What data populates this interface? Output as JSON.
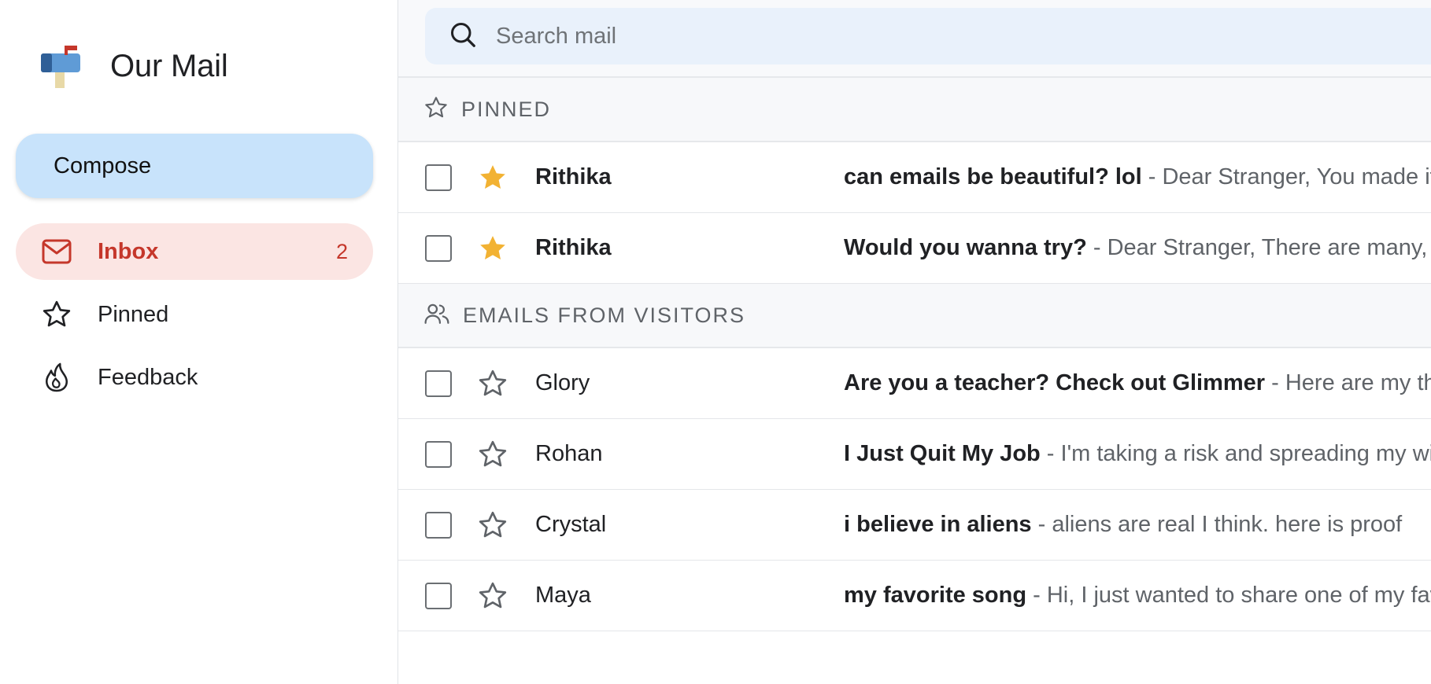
{
  "app": {
    "title": "Our Mail"
  },
  "sidebar": {
    "compose_label": "Compose",
    "items": [
      {
        "label": "Inbox",
        "count": "2",
        "icon": "mail-icon",
        "active": true
      },
      {
        "label": "Pinned",
        "icon": "star-icon"
      },
      {
        "label": "Feedback",
        "icon": "flame-icon"
      }
    ]
  },
  "search": {
    "placeholder": "Search mail"
  },
  "sections": [
    {
      "title": "PINNED",
      "icon": "star-outline-icon",
      "emails": [
        {
          "sender": "Rithika",
          "subject": "can emails be beautiful? lol",
          "separator": " - ",
          "snippet": "Dear Stranger, You made it",
          "starred": true
        },
        {
          "sender": "Rithika",
          "subject": "Would you wanna try?",
          "separator": " - ",
          "snippet": "Dear Stranger, There are many, many",
          "starred": true
        }
      ]
    },
    {
      "title": "EMAILS FROM VISITORS",
      "icon": "users-icon",
      "emails": [
        {
          "sender": "Glory",
          "subject": "Are you a teacher? Check out Glimmer",
          "separator": " - ",
          "snippet": "Here are my thoughts",
          "starred": false
        },
        {
          "sender": "Rohan",
          "subject": "I Just Quit My Job",
          "separator": " - ",
          "snippet": "I'm taking a risk and spreading my wings",
          "starred": false
        },
        {
          "sender": "Crystal",
          "subject": "i believe in aliens",
          "separator": " - ",
          "snippet": "aliens are real I think. here is proof",
          "starred": false
        },
        {
          "sender": "Maya",
          "subject": "my favorite song",
          "separator": " - ",
          "snippet": "Hi, I just wanted to share one of my favorites",
          "starred": false
        }
      ]
    }
  ],
  "colors": {
    "accent_red": "#c5372b",
    "inbox_active_bg": "#fbe5e3",
    "compose_bg": "#c8e3fb",
    "star_filled": "#f2b233",
    "search_bg": "#e9f1fb"
  }
}
